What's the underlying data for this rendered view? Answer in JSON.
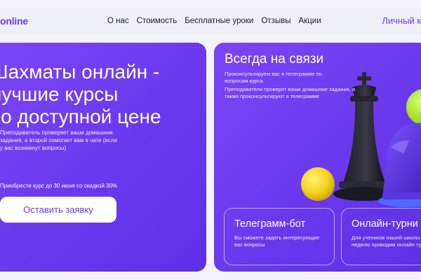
{
  "header": {
    "logo": "online",
    "menu": [
      "О нас",
      "Стоимость",
      "Бесплатные уроки",
      "Отзывы",
      "Акции"
    ],
    "account": "Личный к"
  },
  "hero": {
    "title_lines": [
      "Шахматы онлайн -",
      "лучшие курсы",
      "по доступной цене"
    ],
    "description": "Преподаватель проверяет ваши домашние задания, а второй помогает вам в чате (если у вас возникнут вопросы)",
    "promo": "Приобрести курс до 30 июня со скидкой 30%",
    "button": "Оставить заявку"
  },
  "contact": {
    "title": "Всегда на связи",
    "line1": "Проконсультируем вас в телеграмме по вопросам курса",
    "line2": "Преподаватели проверят ваши домашние задания, а также проконсультируют в телеграмме"
  },
  "cards": [
    {
      "title": "Телеграмм-бот",
      "description": "Вы сможете задать интересующие вас вопросы"
    },
    {
      "title": "Онлайн-турни",
      "description": "Для учеников нашей школы каждую неделю проводим онлайн турниры"
    }
  ],
  "colors": {
    "accent": "#6a3cf0",
    "card": "#6d3bef",
    "background": "#f3f3f9"
  }
}
